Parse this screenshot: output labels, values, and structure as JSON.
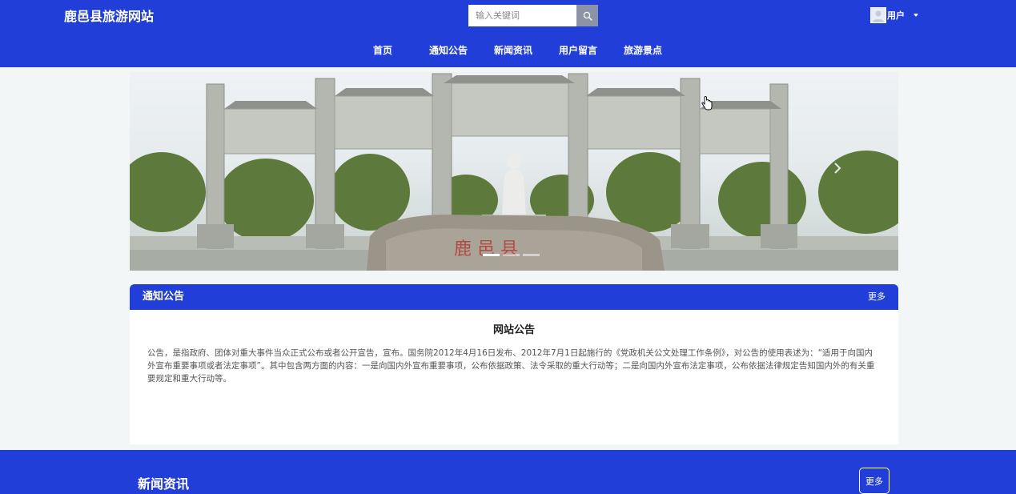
{
  "header": {
    "site_title": "鹿邑县旅游网站",
    "search": {
      "placeholder": "输入关键词",
      "value": ""
    },
    "user": {
      "label": "用户"
    }
  },
  "nav": {
    "items": [
      {
        "label": "首页"
      },
      {
        "label": "通知公告"
      },
      {
        "label": "新闻资讯"
      },
      {
        "label": "用户留言"
      },
      {
        "label": "旅游景点"
      }
    ]
  },
  "banner": {
    "image": "memorial-archway-with-statue",
    "slide_count": 3,
    "active_slide": 1
  },
  "notice": {
    "section_title": "通知公告",
    "more_label": "更多",
    "article_title": "网站公告",
    "article_text": "公告，是指政府、团体对重大事件当众正式公布或者公开宣告，宣布。国务院2012年4月16日发布、2012年7月1日起施行的《党政机关公文处理工作条例》，对公告的使用表述为：“适用于向国内外宣布重要事项或者法定事项”。其中包含两方面的内容：一是向国内外宣布重要事项，公布依据政策、法令采取的重大行动等；二是向国内外宣布法定事项，公布依据法律规定告知国内外的有关重要规定和重大行动等。"
  },
  "news": {
    "section_title": "新闻资讯",
    "more_label": "更多"
  },
  "colors": {
    "primary": "#213fd8",
    "page_bg": "#f3f6f6",
    "search_button": "#8d93a6"
  }
}
